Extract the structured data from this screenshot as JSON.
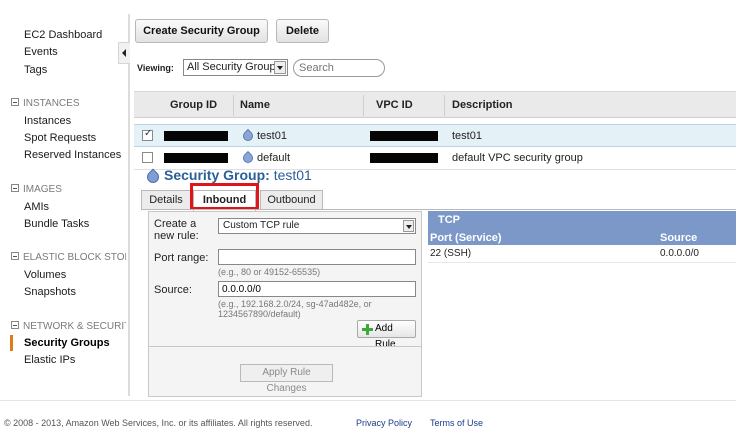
{
  "sidebar": {
    "links_top": [
      "EC2 Dashboard",
      "Events",
      "Tags"
    ],
    "sections": [
      {
        "title": "INSTANCES",
        "items": [
          "Instances",
          "Spot Requests",
          "Reserved Instances"
        ]
      },
      {
        "title": "IMAGES",
        "items": [
          "AMIs",
          "Bundle Tasks"
        ]
      },
      {
        "title": "ELASTIC BLOCK STOR",
        "items": [
          "Volumes",
          "Snapshots"
        ]
      },
      {
        "title": "NETWORK & SECURITY",
        "items": [
          "Security Groups",
          "Elastic IPs"
        ]
      }
    ],
    "active_item": "Security Groups"
  },
  "toolbar": {
    "create_label": "Create Security Group",
    "delete_label": "Delete"
  },
  "filter": {
    "viewing_label": "Viewing:",
    "selected_view": "All Security Groups",
    "search_placeholder": "Search"
  },
  "table": {
    "columns": [
      "Group ID",
      "Name",
      "VPC ID",
      "Description"
    ],
    "rows": [
      {
        "checked": true,
        "group_id_redacted": true,
        "name": "test01",
        "vpc_id_redacted": true,
        "description": "test01"
      },
      {
        "checked": false,
        "group_id_redacted": true,
        "name": "default",
        "vpc_id_redacted": true,
        "description": "default VPC security group"
      }
    ]
  },
  "detail": {
    "title_prefix": "Security Group:",
    "title_name": "test01",
    "tabs": [
      "Details",
      "Inbound",
      "Outbound"
    ],
    "active_tab": "Inbound"
  },
  "rule_form": {
    "create_label": "Create a new rule:",
    "rule_type": "Custom TCP rule",
    "port_label": "Port range:",
    "port_value": "",
    "port_hint": "(e.g., 80 or 49152-65535)",
    "source_label": "Source:",
    "source_value": "0.0.0.0/0",
    "source_hint": "(e.g., 192.168.2.0/24, sg-47ad482e, or 1234567890/default)",
    "add_rule_label": "Add Rule",
    "apply_label": "Apply Rule Changes"
  },
  "rules_table": {
    "protocol": "TCP",
    "columns": [
      "Port (Service)",
      "Source"
    ],
    "rows": [
      {
        "port": "22 (SSH)",
        "source": "0.0.0.0/0"
      }
    ]
  },
  "footer": {
    "copyright": "© 2008 - 2013, Amazon Web Services, Inc. or its affiliates. All rights reserved.",
    "privacy": "Privacy Policy",
    "terms": "Terms of Use"
  },
  "colors": {
    "accent_blue": "#2a5f9a",
    "rules_header": "#7b98c8",
    "highlight_red": "#e0141b",
    "active_marker": "#e07b18"
  }
}
